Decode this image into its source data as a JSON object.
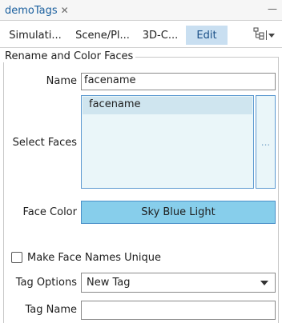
{
  "window": {
    "tab_title": "demoTags",
    "close_glyph": "✕",
    "minimize_glyph": "—"
  },
  "toolbar": {
    "tabs": [
      {
        "label": "Simulati...",
        "active": false
      },
      {
        "label": "Scene/Pl...",
        "active": false
      },
      {
        "label": "3D-C...",
        "active": false
      },
      {
        "label": "Edit",
        "active": true
      }
    ],
    "tree_icon": "tree-hierarchy-icon",
    "dropdown_icon": "chevron-down-icon"
  },
  "group": {
    "title": "Rename and Color Faces"
  },
  "form": {
    "name_label": "Name",
    "name_value": "facename",
    "select_faces_label": "Select Faces",
    "faces_list": [
      "facename"
    ],
    "more_button_label": "...",
    "face_color_label": "Face Color",
    "face_color_value": "Sky Blue Light",
    "face_color_hex": "#87ceeb",
    "unique_checkbox_label": "Make Face Names Unique",
    "unique_checked": false,
    "tag_options_label": "Tag Options",
    "tag_options_value": "New Tag",
    "tag_name_label": "Tag Name",
    "tag_name_value": ""
  },
  "colors": {
    "accent": "#1a5f9e",
    "active_tab_bg": "#c9dff1",
    "list_bg": "#eaf6f9",
    "list_selected_bg": "#cfe5ef"
  }
}
